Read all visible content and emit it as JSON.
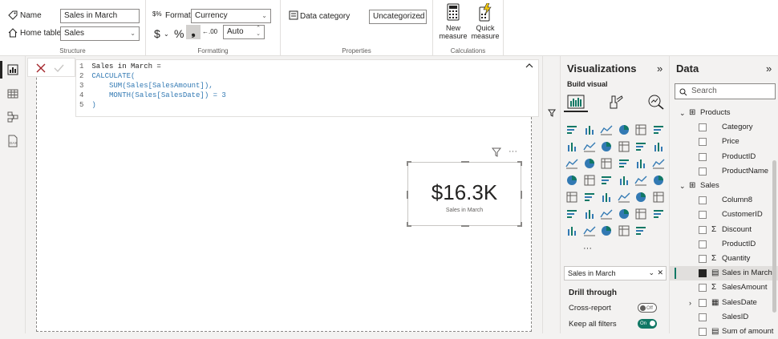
{
  "ribbon": {
    "structure": {
      "name_label": "Name",
      "name_value": "Sales in March",
      "home_table_label": "Home table",
      "home_table_value": "Sales",
      "group_label": "Structure"
    },
    "formatting": {
      "format_label": "Format",
      "format_value": "Currency",
      "currency_symbol": "$",
      "percent_symbol": "%",
      "comma_symbol": "❟",
      "decimal_symbol": "←.00",
      "decimals_value": "Auto",
      "group_label": "Formatting"
    },
    "properties": {
      "data_category_label": "Data category",
      "data_category_value": "Uncategorized",
      "group_label": "Properties"
    },
    "calculations": {
      "new_measure_label": "New measure",
      "quick_measure_label": "Quick measure",
      "group_label": "Calculations"
    }
  },
  "formula": {
    "lines": [
      {
        "n": "1",
        "text": "Sales in March ="
      },
      {
        "n": "2",
        "text": "CALCULATE("
      },
      {
        "n": "3",
        "text": "    SUM(Sales[SalesAmount]),"
      },
      {
        "n": "4",
        "text": "    MONTH(Sales[SalesDate]) = 3"
      },
      {
        "n": "5",
        "text": ")"
      }
    ]
  },
  "card": {
    "value": "$16.3K",
    "label": "Sales in March",
    "more_symbol": "···"
  },
  "visualizations": {
    "title": "Visualizations",
    "collapse_symbol": "»",
    "build_visual_label": "Build visual",
    "more_visuals": "···",
    "field_well_value": "Sales in March",
    "drill_through_label": "Drill through",
    "cross_report_label": "Cross-report",
    "cross_report_state": "Off",
    "keep_filters_label": "Keep all filters",
    "keep_filters_state": "On"
  },
  "data_pane": {
    "title": "Data",
    "collapse_symbol": "»",
    "search_placeholder": "Search",
    "tables": [
      {
        "name": "Products",
        "fields": [
          "Category",
          "Price",
          "ProductID",
          "ProductName"
        ]
      },
      {
        "name": "Sales",
        "fields": [
          "Column8",
          "CustomerID",
          "Discount",
          "ProductID",
          "Quantity",
          "Sales in March",
          "SalesAmount",
          "SalesDate",
          "SalesID",
          "Sum of amount"
        ]
      }
    ]
  },
  "colors": {
    "accent_green": "#117865",
    "ribbon_bg": "#ffffff",
    "pane_bg": "#f3f2f1"
  }
}
